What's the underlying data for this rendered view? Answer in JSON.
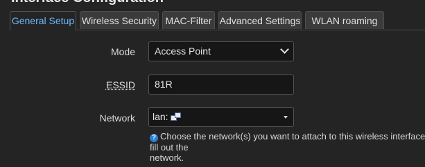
{
  "section": {
    "title": "Interface Configuration"
  },
  "tabs": [
    {
      "label": "General Setup",
      "active": true
    },
    {
      "label": "Wireless Security",
      "active": false
    },
    {
      "label": "MAC-Filter",
      "active": false
    },
    {
      "label": "Advanced Settings",
      "active": false
    },
    {
      "label": "WLAN roaming",
      "active": false
    }
  ],
  "form": {
    "mode": {
      "label": "Mode",
      "value": "Access Point"
    },
    "essid": {
      "label": "ESSID",
      "value": "81R"
    },
    "network": {
      "label": "Network",
      "value": "lan:",
      "icon": "network-icon",
      "help_icon": "question-icon",
      "help": "Choose the network(s) you want to attach to this wireless interface or fill out the",
      "help_line2": "network."
    }
  },
  "colors": {
    "background": "#242424",
    "active_tab_text": "#6db8ff",
    "help_icon": "#2b7fd6"
  }
}
